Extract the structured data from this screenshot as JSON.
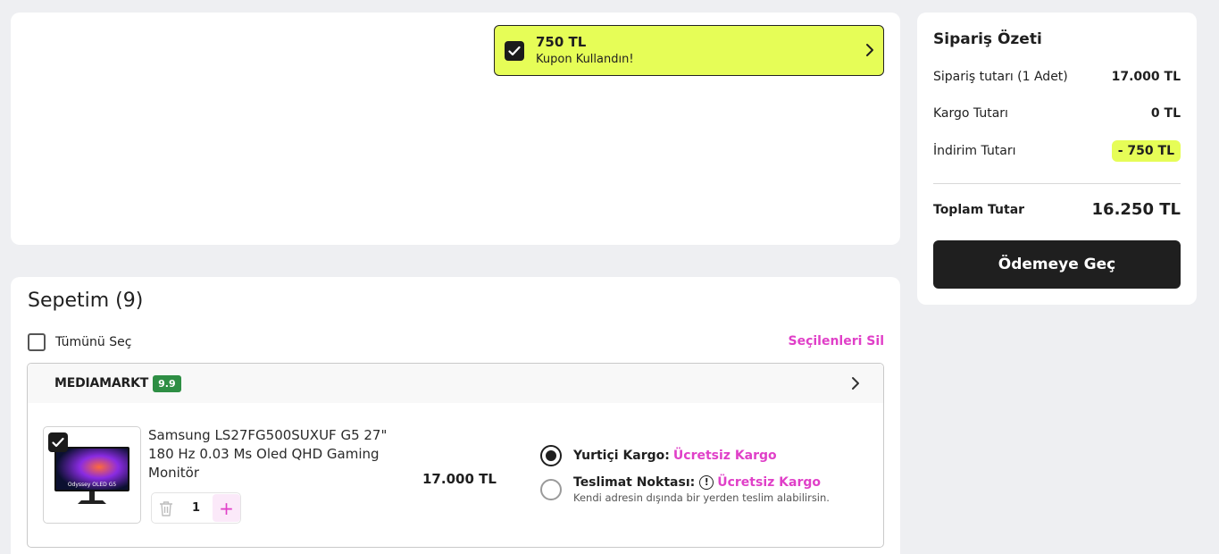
{
  "coupon": {
    "amount": "750 TL",
    "status": "Kupon Kullandın!"
  },
  "cart": {
    "title": "Sepetim (9)",
    "select_all_label": "Tümünü Seç",
    "delete_selected_label": "Seçilenleri Sil",
    "seller": {
      "name": "MEDIAMARKT",
      "rating": "9.9"
    },
    "item": {
      "name": "Samsung LS27FG500SUXUF G5 27\" 180 Hz 0.03 Ms Oled QHD Gaming Monitör",
      "price": "17.000 TL",
      "quantity": "1",
      "image_caption": "Odyssey OLED G5"
    },
    "shipping": [
      {
        "label": "Yurtiçi Kargo:",
        "value": "Ücretsiz Kargo",
        "selected": true
      },
      {
        "label": "Teslimat Noktası:",
        "value": "Ücretsiz Kargo",
        "note": "Kendi adresin dışında bir yerden teslim alabilirsin.",
        "selected": false
      }
    ]
  },
  "summary": {
    "title": "Sipariş Özeti",
    "order_amount_label": "Sipariş tutarı (1 Adet)",
    "order_amount_value": "17.000 TL",
    "shipping_label": "Kargo Tutarı",
    "shipping_value": "0 TL",
    "discount_label": "İndirim Tutarı",
    "discount_value": "- 750 TL",
    "total_label": "Toplam Tutar",
    "total_value": "16.250 TL",
    "pay_button": "Ödemeye Geç"
  },
  "colors": {
    "accent_lime": "#e6fd57",
    "accent_pink": "#e040c8",
    "rating_green": "#2e8e44",
    "dark": "#1f1f1f"
  }
}
